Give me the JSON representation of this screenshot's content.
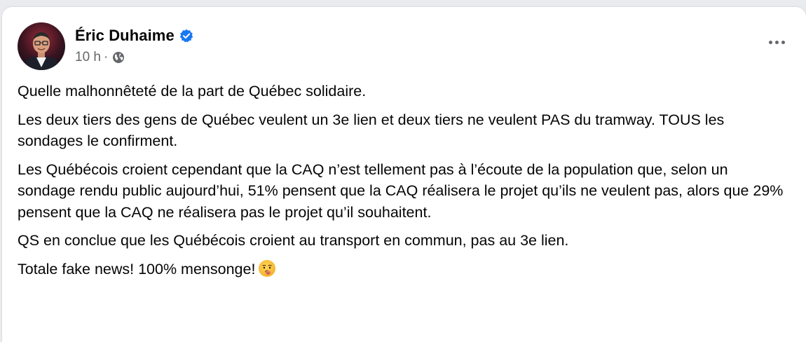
{
  "post": {
    "author_name": "Éric Duhaime",
    "timestamp": "10 h",
    "separator": "·",
    "paragraphs": [
      "Quelle malhonnêteté de la part de Québec solidaire.",
      "Les deux tiers des gens de Québec veulent un 3e lien et deux tiers ne veulent PAS du tramway. TOUS les sondages le confirment.",
      "Les Québécois croient cependant que la CAQ n’est tellement pas à l’écoute de la population que, selon un sondage rendu public aujourd’hui, 51% pensent que la CAQ réalisera le projet qu’ils ne veulent pas, alors que 29% pensent que la CAQ ne réalisera pas le projet qu’il souhaitent.",
      "QS en conclue que les Québécois croient au transport en commun, pas au 3e lien.",
      "Totale fake news! 100% mensonge!"
    ],
    "icons": {
      "verified": "verified-badge-icon",
      "audience": "globe-icon",
      "menu": "more-options-icon",
      "emoji": "lying-face-emoji"
    },
    "colors": {
      "verified_badge": "#1877f2",
      "secondary_text": "#65676b",
      "primary_text": "#050505"
    }
  }
}
